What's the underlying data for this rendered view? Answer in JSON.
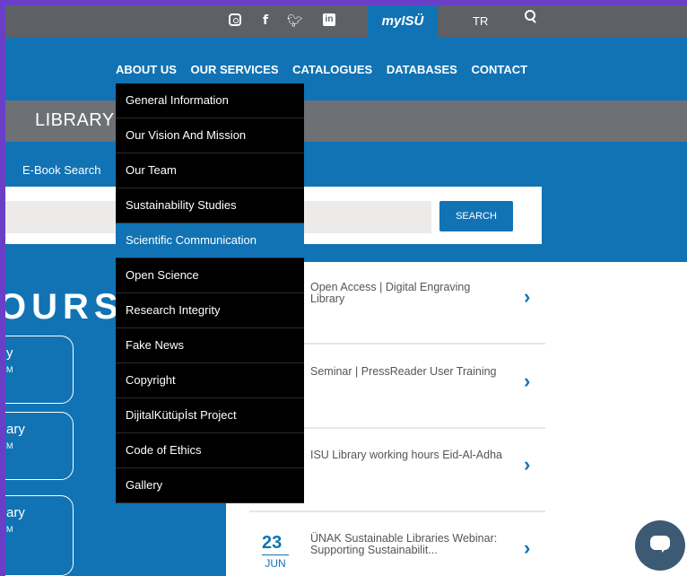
{
  "topbar": {
    "myisu": "myISÜ",
    "lang": "TR"
  },
  "nav": [
    "ABOUT US",
    "OUR SERVICES",
    "CATALOGUES",
    "DATABASES",
    "CONTACT"
  ],
  "band_title": "LIBRARY",
  "ebook_tab": "E-Book Search",
  "search_button": "SEARCH",
  "hours_heading": "OURS",
  "cards": [
    {
      "l1": "y",
      "l2": "M"
    },
    {
      "l1": "ary",
      "l2": "M"
    },
    {
      "l1": "ary",
      "l2": "M"
    }
  ],
  "news": [
    {
      "title": "Open Access | Digital Engraving Library"
    },
    {
      "title": "Seminar | PressReader User Training"
    },
    {
      "title": "ISU Library working hours Eid-Al-Adha"
    },
    {
      "title": "ÜNAK Sustainable Libraries Webinar: Supporting Sustainabilit...",
      "day": "23",
      "month": "JUN"
    }
  ],
  "dropdown": [
    "General Information",
    "Our Vision And Mission",
    "Our Team",
    "Sustainability Studies",
    "Scientific Communication",
    "Open Science",
    "Research Integrity",
    "Fake News",
    "Copyright",
    "DijitalKütüpİst Project",
    "Code of Ethics",
    "Gallery"
  ],
  "dropdown_active": "Scientific Communication",
  "colors": {
    "brand_blue": "#1173b4",
    "topbar_gray": "#5d6166",
    "frame": "#6a3fc8"
  }
}
